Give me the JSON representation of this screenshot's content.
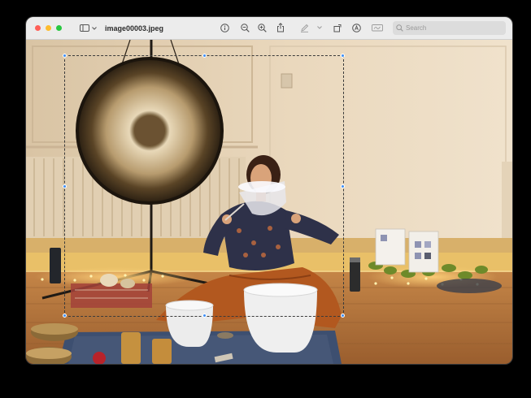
{
  "window": {
    "title": "image00003.jpeg"
  },
  "toolbar": {
    "search_placeholder": "Search",
    "icons": [
      "sidebar-icon",
      "chevron-down-icon",
      "info-icon",
      "zoom-out-icon",
      "zoom-in-icon",
      "share-icon",
      "markup-pen-icon",
      "chevron-down-icon",
      "rotate-icon",
      "annotate-icon",
      "signature-icon",
      "search-icon"
    ]
  },
  "colors": {
    "titlebar": "#ececec",
    "selection_handle": "#3d8ef5",
    "wall": "#ecdcc3",
    "floor": "#b5763f",
    "skirt": "#b2581f"
  }
}
